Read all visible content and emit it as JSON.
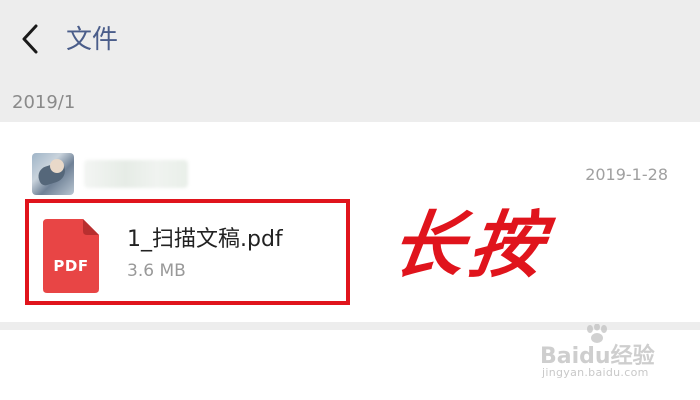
{
  "header": {
    "title": "文件",
    "back_icon": "chevron-left-icon"
  },
  "section": {
    "date": "2019/1"
  },
  "message": {
    "time": "2019-1-28",
    "file": {
      "name": "1_扫描文稿.pdf",
      "size": "3.6 MB",
      "type_label": "PDF",
      "icon_color": "#e84545"
    }
  },
  "annotation": {
    "text": "长按",
    "color": "#e0141c"
  },
  "watermark": {
    "brand": "Baidu经验",
    "url": "jingyan.baidu.com"
  },
  "colors": {
    "header_bg": "#ededed",
    "title": "#4a5d8a",
    "highlight_border": "#e0141c"
  }
}
